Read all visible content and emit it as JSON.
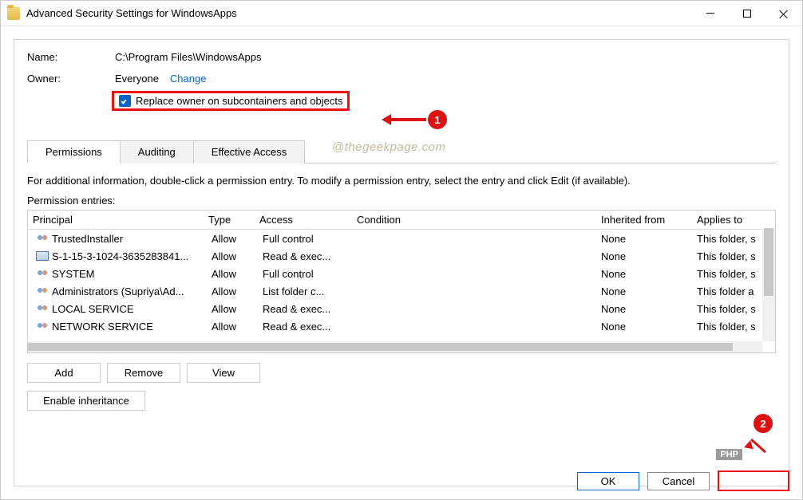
{
  "title": "Advanced Security Settings for WindowsApps",
  "name_label": "Name:",
  "name_value": "C:\\Program Files\\WindowsApps",
  "owner_label": "Owner:",
  "owner_value": "Everyone",
  "change_link": "Change",
  "replace_owner_label": "Replace owner on subcontainers and objects",
  "watermark": "@thegeekpage.com",
  "tabs": {
    "permissions": "Permissions",
    "auditing": "Auditing",
    "effective": "Effective Access"
  },
  "hint_text": "For additional information, double-click a permission entry. To modify a permission entry, select the entry and click Edit (if available).",
  "entries_label": "Permission entries:",
  "columns": {
    "principal": "Principal",
    "type": "Type",
    "access": "Access",
    "condition": "Condition",
    "inherited": "Inherited from",
    "applies": "Applies to"
  },
  "rows": [
    {
      "icon": "users",
      "principal": "TrustedInstaller",
      "type": "Allow",
      "access": "Full control",
      "condition": "",
      "inherited": "None",
      "applies": "This folder, s"
    },
    {
      "icon": "sid",
      "principal": "S-1-15-3-1024-3635283841...",
      "type": "Allow",
      "access": "Read & exec...",
      "condition": "",
      "inherited": "None",
      "applies": "This folder, s"
    },
    {
      "icon": "users",
      "principal": "SYSTEM",
      "type": "Allow",
      "access": "Full control",
      "condition": "",
      "inherited": "None",
      "applies": "This folder, s"
    },
    {
      "icon": "users",
      "principal": "Administrators (Supriya\\Ad...",
      "type": "Allow",
      "access": "List folder c...",
      "condition": "",
      "inherited": "None",
      "applies": "This folder a"
    },
    {
      "icon": "users",
      "principal": "LOCAL SERVICE",
      "type": "Allow",
      "access": "Read & exec...",
      "condition": "",
      "inherited": "None",
      "applies": "This folder, s"
    },
    {
      "icon": "users",
      "principal": "NETWORK SERVICE",
      "type": "Allow",
      "access": "Read & exec...",
      "condition": "",
      "inherited": "None",
      "applies": "This folder, s"
    }
  ],
  "buttons": {
    "add": "Add",
    "remove": "Remove",
    "view": "View",
    "enable_inh": "Enable inheritance",
    "ok": "OK",
    "cancel": "Cancel"
  },
  "annotations": {
    "step1": "1",
    "step2": "2",
    "php": "PHP"
  }
}
